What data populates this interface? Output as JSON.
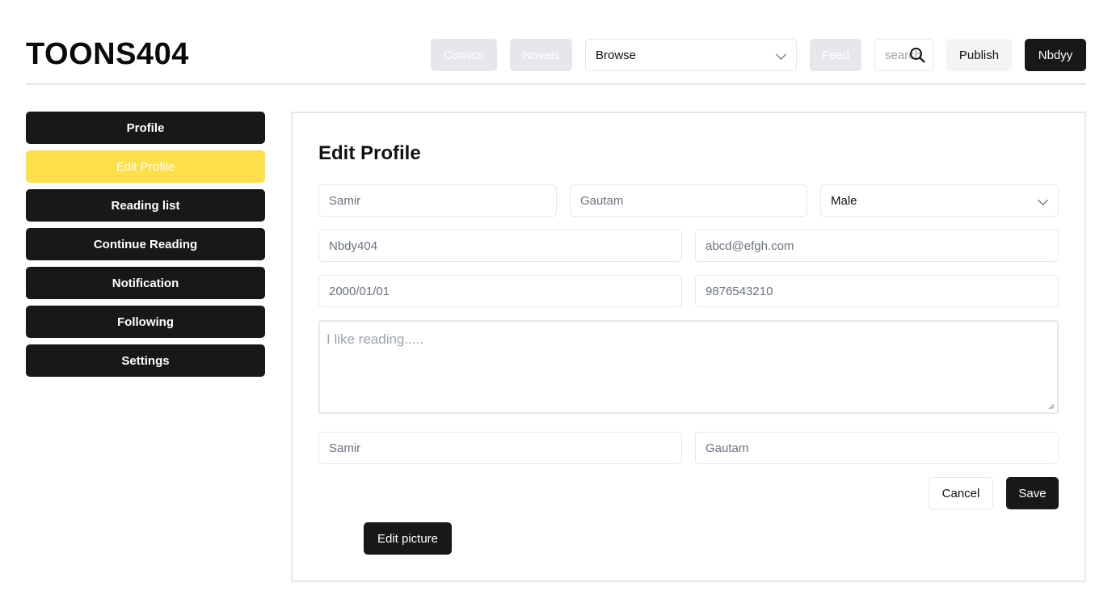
{
  "header": {
    "logo": "TOONS404",
    "nav": {
      "comics": "Comics",
      "novels": "Novels",
      "browse": "Browse",
      "feed": "Feed"
    },
    "search_placeholder": "search",
    "publish": "Publish",
    "user": "Nbdyy"
  },
  "sidebar": {
    "items": [
      {
        "label": "Profile"
      },
      {
        "label": "Edit Profile"
      },
      {
        "label": "Reading list"
      },
      {
        "label": "Continue Reading"
      },
      {
        "label": "Notification"
      },
      {
        "label": "Following"
      },
      {
        "label": "Settings"
      }
    ]
  },
  "form": {
    "title": "Edit Profile",
    "first_name": "Samir",
    "last_name": "Gautam",
    "gender": "Male",
    "username": "Nbdy404",
    "email": "abcd@efgh.com",
    "dob": "2000/01/01",
    "phone": "9876543210",
    "bio_placeholder": "I like reading.....",
    "extra_first": "Samir",
    "extra_last": "Gautam",
    "cancel": "Cancel",
    "save": "Save",
    "edit_picture": "Edit picture"
  },
  "colors": {
    "dark": "#18181b",
    "active": "#fde047",
    "disabled": "#e5e7eb",
    "border": "#e5e7eb"
  }
}
